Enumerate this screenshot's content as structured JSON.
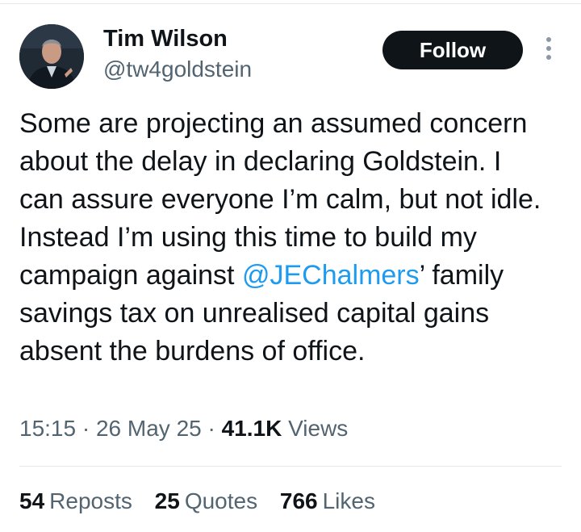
{
  "author": {
    "display_name": "Tim Wilson",
    "handle": "@tw4goldstein",
    "avatar_icon": "profile-photo"
  },
  "follow_button": {
    "label": "Follow"
  },
  "more_menu": {
    "icon": "more-vertical-icon"
  },
  "tweet": {
    "text_before": "Some are projecting an assumed concern about the delay in declaring Goldstein. I can assure everyone I’m calm, but not idle. Instead I’m using this time to build my campaign against ",
    "mention": "@JEChalmers",
    "text_after": "’ family savings tax on unrealised capital gains absent the burdens of office."
  },
  "meta": {
    "time": "15:15",
    "separator": "·",
    "date": "26 May 25",
    "views_count": "41.1K",
    "views_label": "Views"
  },
  "stats": {
    "reposts": {
      "count": "54",
      "label": "Reposts"
    },
    "quotes": {
      "count": "25",
      "label": "Quotes"
    },
    "likes": {
      "count": "766",
      "label": "Likes"
    }
  },
  "colors": {
    "text": "#0f1419",
    "secondary": "#536471",
    "link": "#1d9bf0",
    "button_bg": "#0f1419"
  }
}
